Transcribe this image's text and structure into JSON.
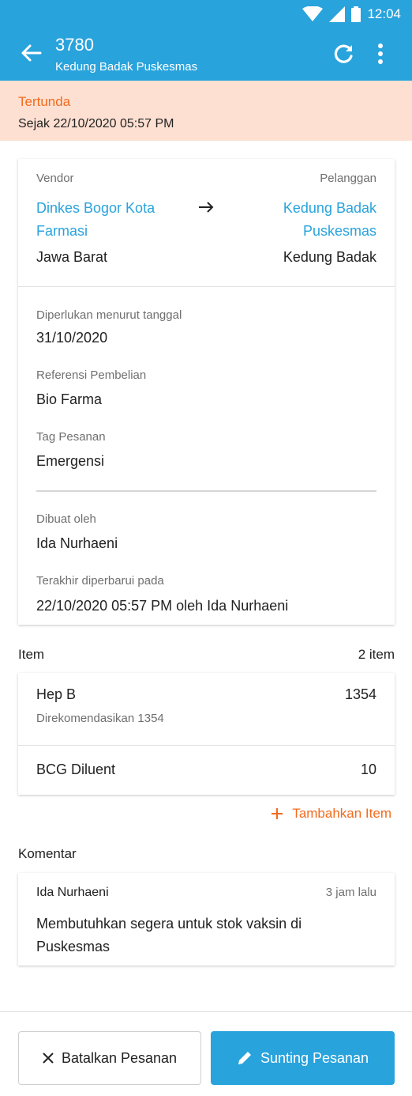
{
  "status_bar": {
    "time": "12:04"
  },
  "header": {
    "title": "3780",
    "subtitle": "Kedung Badak Puskesmas"
  },
  "banner": {
    "status": "Tertunda",
    "since": "Sejak 22/10/2020 05:57 PM"
  },
  "parties": {
    "vendor_label": "Vendor",
    "vendor_name_line1": "Dinkes Bogor Kota",
    "vendor_name_line2": "Farmasi",
    "vendor_region": "Jawa Barat",
    "customer_label": "Pelanggan",
    "customer_name_line1": "Kedung Badak",
    "customer_name_line2": "Puskesmas",
    "customer_region": "Kedung Badak"
  },
  "details": {
    "needed_by_label": "Diperlukan menurut tanggal",
    "needed_by_value": "31/10/2020",
    "purchase_ref_label": "Referensi Pembelian",
    "purchase_ref_value": "Bio Farma",
    "order_tag_label": "Tag Pesanan",
    "order_tag_value": "Emergensi",
    "created_by_label": "Dibuat oleh",
    "created_by_value": "Ida Nurhaeni",
    "updated_label": "Terakhir diperbarui pada",
    "updated_value": "22/10/2020 05:57 PM oleh Ida Nurhaeni"
  },
  "items_section": {
    "title": "Item",
    "count": "2 item",
    "items": [
      {
        "name": "Hep B",
        "qty": "1354",
        "recommended": "Direkomendasikan 1354"
      },
      {
        "name": "BCG Diluent",
        "qty": "10"
      }
    ],
    "add_label": "Tambahkan Item"
  },
  "comments_section": {
    "title": "Komentar",
    "comments": [
      {
        "author": "Ida Nurhaeni",
        "time": "3 jam lalu",
        "text_line1": "Membutuhkan segera untuk stok vaksin di",
        "text_line2": "Puskesmas"
      }
    ]
  },
  "actions": {
    "cancel_label": "Batalkan Pesanan",
    "edit_label": "Sunting Pesanan"
  },
  "colors": {
    "primary": "#29a3dc",
    "accent": "#f26b1d",
    "banner_bg": "#fde0d2"
  }
}
